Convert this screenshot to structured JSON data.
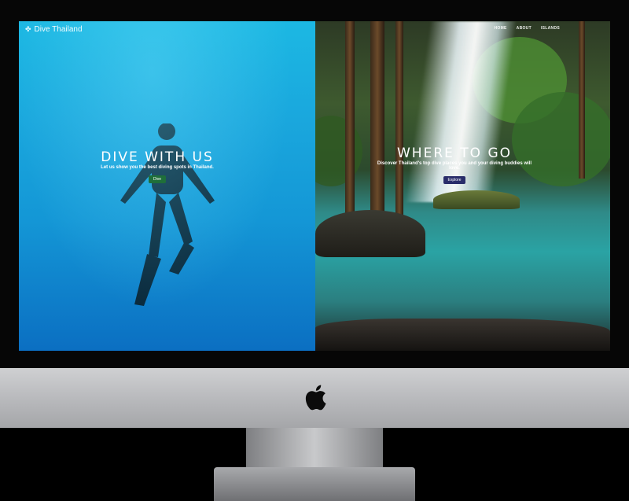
{
  "nav": {
    "brand": "Dive Thailand",
    "links": [
      "HOME",
      "ABOUT",
      "ISLANDS"
    ]
  },
  "hero_left": {
    "title": "DIVE WITH US",
    "subtitle": "Let us show you the best diving spots in Thailand.",
    "button": "Dive"
  },
  "hero_right": {
    "title": "WHERE TO GO",
    "subtitle": "Discover Thailand's top dive places you and your diving buddies will love.",
    "button": "Explore"
  },
  "colors": {
    "ocean": "#1aa7dd",
    "dive_button": "#1f6f3a",
    "explore_button": "#2a2d6a",
    "lagoon": "#2aa3a4"
  },
  "icons": [
    "logo-icon",
    "apple-logo-icon"
  ]
}
